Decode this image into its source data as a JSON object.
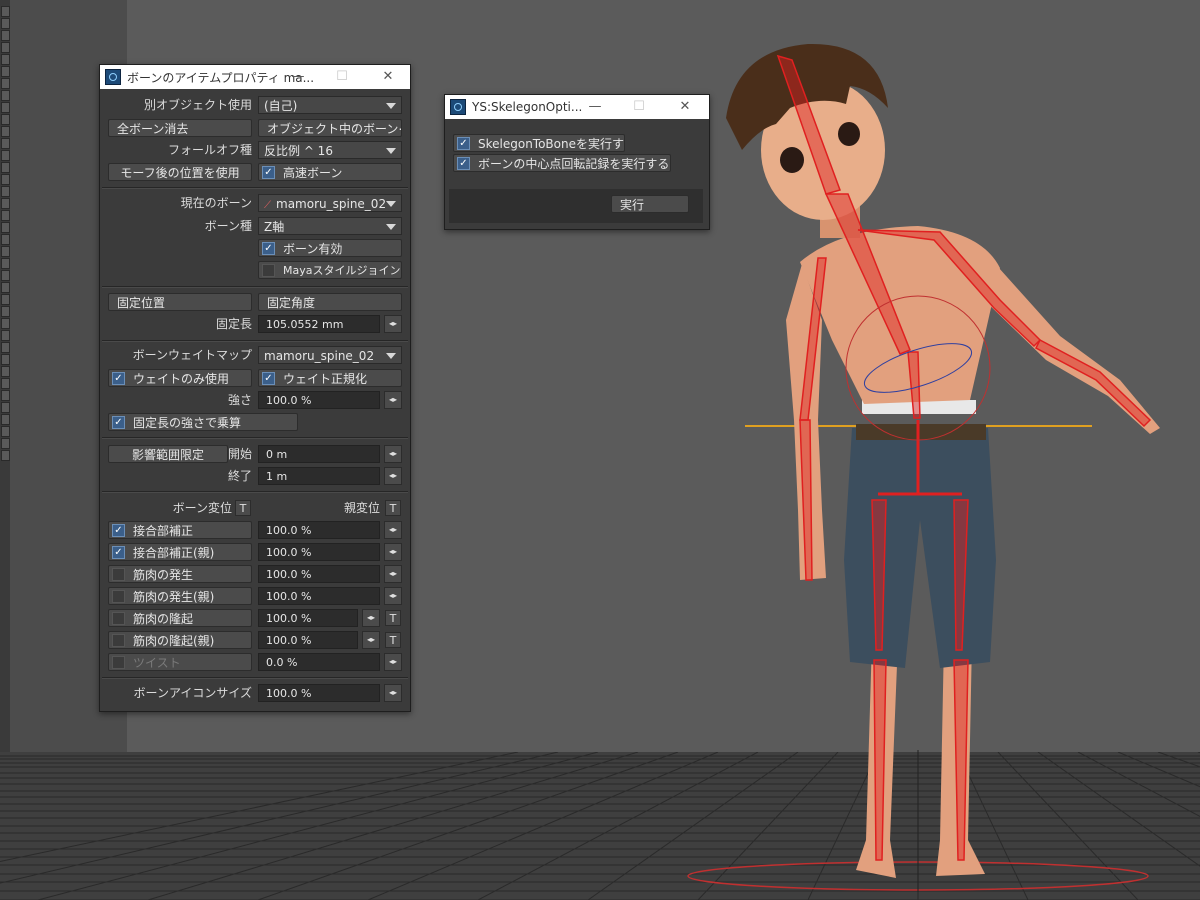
{
  "bone_props": {
    "title": "ボーンのアイテムプロパティ ma...",
    "other_object_label": "別オブジェクト使用",
    "other_object_value": "(自己)",
    "clear_all_bones": "全ボーン消去",
    "bones_in_object": "オブジェクト中のボーン⋯",
    "falloff_label": "フォールオフ種",
    "falloff_value": "反比例 ^ 16",
    "use_morphed_positions": "モーフ後の位置を使用",
    "faster_bones": "高速ボーン",
    "current_bone_label": "現在のボーン",
    "current_bone_value": "mamoru_spine_02",
    "bone_type_label": "ボーン種",
    "bone_type_value": "Z軸",
    "bone_active": "ボーン有効",
    "maya_joint": "Mayaスタイルジョイント",
    "rest_position": "固定位置",
    "rest_rotation": "固定角度",
    "rest_length_label": "固定長",
    "rest_length_value": "105.0552 mm",
    "weightmap_label": "ボーンウェイトマップ",
    "weightmap_value": "mamoru_spine_02",
    "weight_only": "ウェイトのみ使用",
    "normalize_weights": "ウェイト正規化",
    "strength_label": "強さ",
    "strength_value": "100.0 %",
    "multiply_rest_length": "固定長の強さで乗算",
    "limited_range": "影響範囲限定",
    "start_label": "開始",
    "start_value": "0 m",
    "end_label": "終了",
    "end_value": "1 m",
    "bone_xform_label": "ボーン変位",
    "parent_xform_label": "親変位",
    "t_label": "T",
    "joint_comp": "接合部補正",
    "joint_comp_value": "100.0 %",
    "joint_comp_parent": "接合部補正(親)",
    "joint_comp_parent_value": "100.0 %",
    "muscle_flex": "筋肉の発生",
    "muscle_flex_value": "100.0 %",
    "muscle_flex_parent": "筋肉の発生(親)",
    "muscle_flex_parent_value": "100.0 %",
    "muscle_bulge": "筋肉の隆起",
    "muscle_bulge_value": "100.0 %",
    "muscle_bulge_parent": "筋肉の隆起(親)",
    "muscle_bulge_parent_value": "100.0 %",
    "twist": "ツイスト",
    "twist_value": "0.0 %",
    "icon_size_label": "ボーンアイコンサイズ",
    "icon_size_value": "100.0 %"
  },
  "skelegon": {
    "title": "YS:SkelegonOpti...",
    "run_skelegon_to_bone": "SkelegonToBoneを実行する",
    "record_pivot_rotation": "ボーンの中心点回転記録を実行する",
    "execute": "実行"
  },
  "window_controls": {
    "minimize": "—",
    "maximize": "☐",
    "close": "✕"
  },
  "glyphs": {
    "check": "✓",
    "stepper": "◂▸"
  },
  "colors": {
    "bone": "#e02020",
    "skin": "#e2a07e",
    "hair": "#4a2e1a",
    "jeans": "#3c4e5e",
    "check_accent": "#3b5f8a",
    "ground_line": "#e0a020"
  }
}
